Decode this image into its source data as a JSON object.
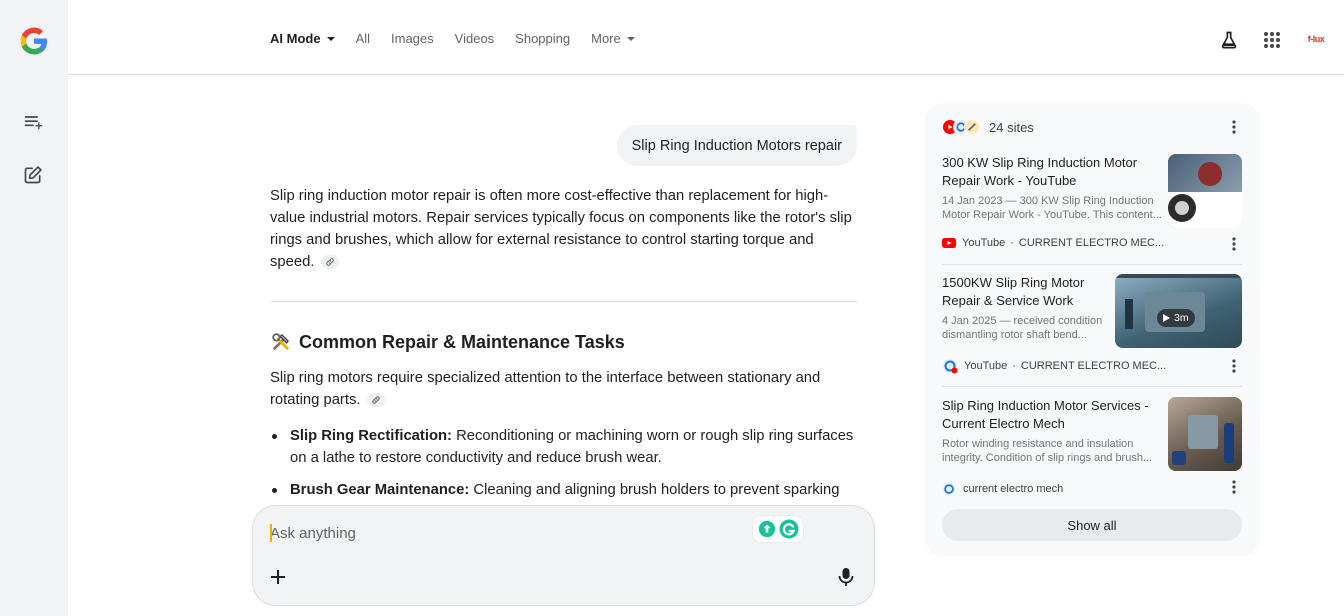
{
  "nav": {
    "tabs": [
      {
        "label": "AI Mode",
        "active": true,
        "has_caret": true
      },
      {
        "label": "All"
      },
      {
        "label": "Images"
      },
      {
        "label": "Videos"
      },
      {
        "label": "Shopping"
      },
      {
        "label": "More",
        "has_caret": true
      }
    ],
    "icons": [
      "labs-flask-icon",
      "apps-grid-icon",
      "account-logo"
    ],
    "account_logo_text": "f-lux"
  },
  "rail": {
    "icons": [
      "google-logo",
      "history-list-icon",
      "new-chat-icon"
    ]
  },
  "conversation": {
    "query": "Slip Ring Induction Motors repair",
    "intro": "Slip ring induction motor repair is often more cost-effective than replacement for high-value industrial motors. Repair services typically focus on components like the rotor's slip rings and brushes, which allow for external resistance to control starting torque and speed.",
    "section_title": "Common Repair & Maintenance Tasks",
    "section_icon": "tools-emoji",
    "section_intro": "Slip ring motors require specialized attention to the interface between stationary and rotating parts.",
    "bullets": [
      {
        "bold": "Slip Ring Rectification:",
        "text": " Reconditioning or machining worn or rough slip ring surfaces on a lathe to restore conductivity and reduce brush wear."
      },
      {
        "bold": "Brush Gear Maintenance:",
        "text": " Cleaning and aligning brush holders to prevent sparking"
      }
    ]
  },
  "ask": {
    "placeholder": "Ask anything",
    "plus_icon": "plus-icon",
    "mic_icon": "mic-icon"
  },
  "sources": {
    "count_label": "24 sites",
    "cards": [
      {
        "title": "300 KW Slip Ring Induction Motor Repair Work - YouTube",
        "snippet": "14 Jan 2023 — 300 KW Slip Ring Induction Motor Repair Work - YouTube. This content...",
        "source": "YouTube",
        "channel": "CURRENT ELECTRO MEC..."
      },
      {
        "title": "1500KW Slip Ring Motor Repair & Service Work",
        "snippet": "4 Jan 2025 — received condition dismantling rotor shaft bend...",
        "source": "YouTube",
        "channel": "CURRENT ELECTRO MEC...",
        "duration": "3m"
      },
      {
        "title": "Slip Ring Induction Motor Services - Current Electro Mech",
        "snippet": "Rotor winding resistance and insulation integrity. Condition of slip rings and brush...",
        "source": "current electro mech"
      }
    ],
    "show_all_label": "Show all"
  },
  "colors": {
    "rail_bg": "#f1f3f4",
    "youtube_red": "#ff0000",
    "accent_blue": "#1a73e8",
    "grammarly_green": "#15c39a"
  }
}
